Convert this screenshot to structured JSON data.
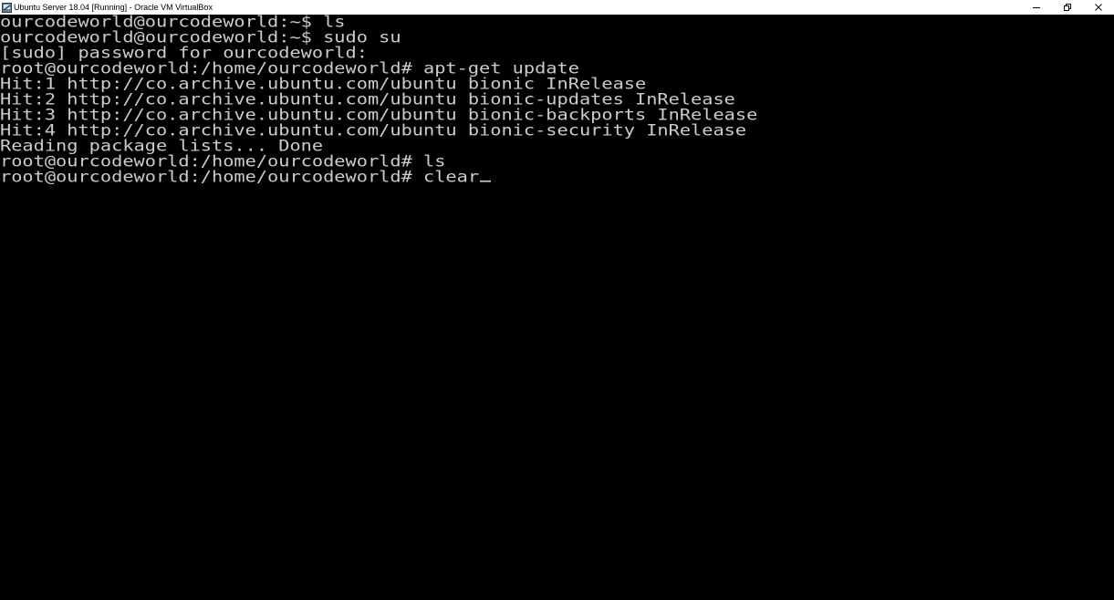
{
  "window": {
    "title": "Ubuntu Server 18.04 [Running] - Oracle VM VirtualBox",
    "app_icon": "virtualbox-icon",
    "controls": {
      "minimize": "minimize-icon",
      "restore": "restore-icon",
      "close": "close-icon"
    }
  },
  "terminal": {
    "lines": [
      "ourcodeworld@ourcodeworld:~$ ls",
      "ourcodeworld@ourcodeworld:~$ sudo su",
      "[sudo] password for ourcodeworld:",
      "root@ourcodeworld:/home/ourcodeworld# apt-get update",
      "Hit:1 http://co.archive.ubuntu.com/ubuntu bionic InRelease",
      "Hit:2 http://co.archive.ubuntu.com/ubuntu bionic-updates InRelease",
      "Hit:3 http://co.archive.ubuntu.com/ubuntu bionic-backports InRelease",
      "Hit:4 http://co.archive.ubuntu.com/ubuntu bionic-security InRelease",
      "Reading package lists... Done",
      "root@ourcodeworld:/home/ourcodeworld# ls",
      "root@ourcodeworld:/home/ourcodeworld# clear"
    ],
    "colors": {
      "background": "#000000",
      "foreground": "#cccccc"
    }
  }
}
